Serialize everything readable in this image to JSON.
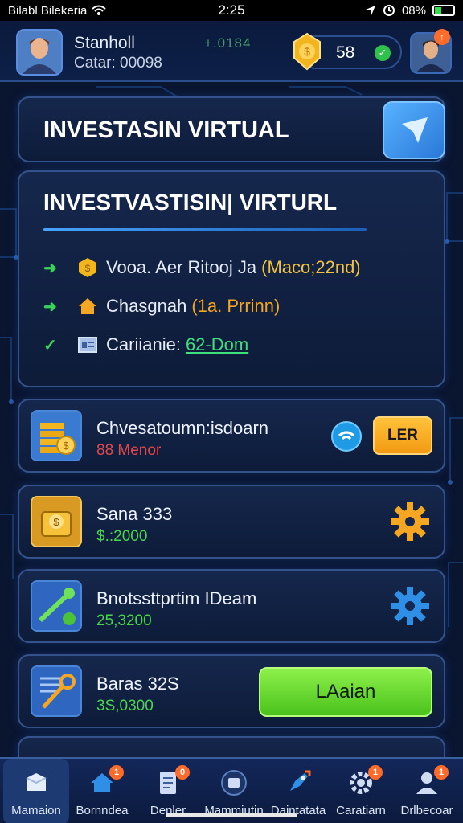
{
  "status_bar": {
    "carrier": "Bilabl Bilekeria",
    "time": "2:25",
    "battery": "08%",
    "battery_level": 0.35
  },
  "header": {
    "user_name": "Stanholl",
    "user_sub": "Catar: 00098",
    "rating": "+.0184",
    "coins": "58"
  },
  "title_card": {
    "title": "INVESTASIN VIRTUAL"
  },
  "info_card": {
    "title": "INVESTVASTISIN| VIRTURL",
    "rows": [
      {
        "label": "Vooa. Aer Ritooj Ja",
        "highlight": "(Maco;22nd)",
        "highlight_color": "#f5c23a"
      },
      {
        "label": "Chasgnah",
        "highlight": "(1a. Prrinn)",
        "highlight_color": "#f5a623"
      },
      {
        "label": "Cariianie:",
        "highlight": "62-Dom",
        "highlight_color": "#3ee07a"
      }
    ]
  },
  "items": [
    {
      "title": "Chvesatoumn:isdoarn",
      "sub": "88 Menor",
      "sub_color": "#e2484c",
      "action": "LER"
    },
    {
      "title": "Sana 333",
      "sub": "$.:2000",
      "sub_color": "#46d84a"
    },
    {
      "title": "Bnotssttprtim IDeam",
      "sub": "25,3200",
      "sub_color": "#46d84a"
    },
    {
      "title": "Baras 32S",
      "sub": "3S,0300",
      "sub_color": "#46d84a",
      "action": "LAaian"
    }
  ],
  "nav": {
    "items": [
      {
        "label": "Mamaion"
      },
      {
        "label": "Bornndea",
        "badge": "1"
      },
      {
        "label": "Denler",
        "badge": "0"
      },
      {
        "label": "Mammiutin"
      },
      {
        "label": "Daintatata"
      },
      {
        "label": "Caratiarn",
        "badge": "1"
      },
      {
        "label": "Drlbecoar",
        "badge": "1"
      }
    ]
  },
  "colors": {
    "accent": "#2a78d8",
    "positive": "#46d84a",
    "negative": "#e2484c",
    "gold": "#f5c23a"
  }
}
